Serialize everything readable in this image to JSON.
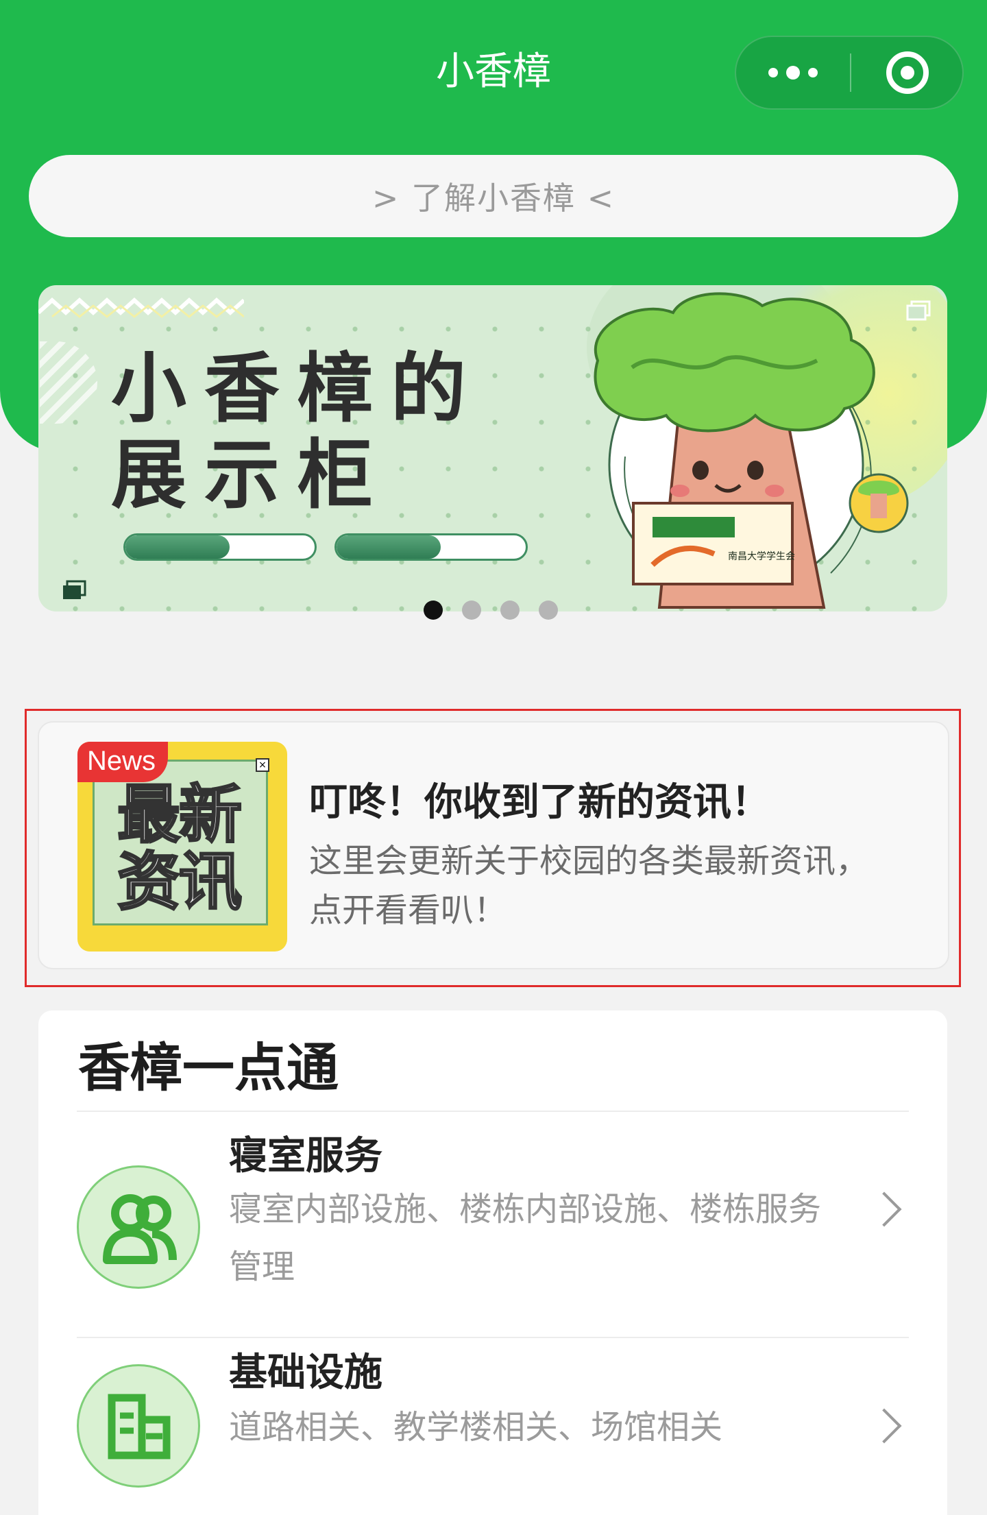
{
  "app": {
    "title": "小香樟"
  },
  "learn_pill": {
    "label": "> 了解小香樟 <"
  },
  "banner": {
    "title_line1": "小香樟的",
    "title_line2": "展示柜",
    "progress": [
      0.55,
      0.55
    ],
    "dots_total": 4,
    "active_dot": 0,
    "mascot_box_text": "南昌大学学生会"
  },
  "news": {
    "tag": "News",
    "thumb_line1": "最新",
    "thumb_line2": "资讯",
    "title": "叮咚！你收到了新的资讯！",
    "description": "这里会更新关于校园的各类最新资讯，点开看看叭！"
  },
  "services": {
    "title": "香樟一点通",
    "items": [
      {
        "name": "寝室服务",
        "description": "寝室内部设施、楼栋内部设施、楼栋服务管理",
        "icon": "users-icon"
      },
      {
        "name": "基础设施",
        "description": "道路相关、教学楼相关、场馆相关",
        "icon": "building-icon"
      }
    ]
  },
  "colors": {
    "brand": "#1fba4d",
    "highlight": "#e02b2b",
    "icon_green": "#3fae3a"
  }
}
